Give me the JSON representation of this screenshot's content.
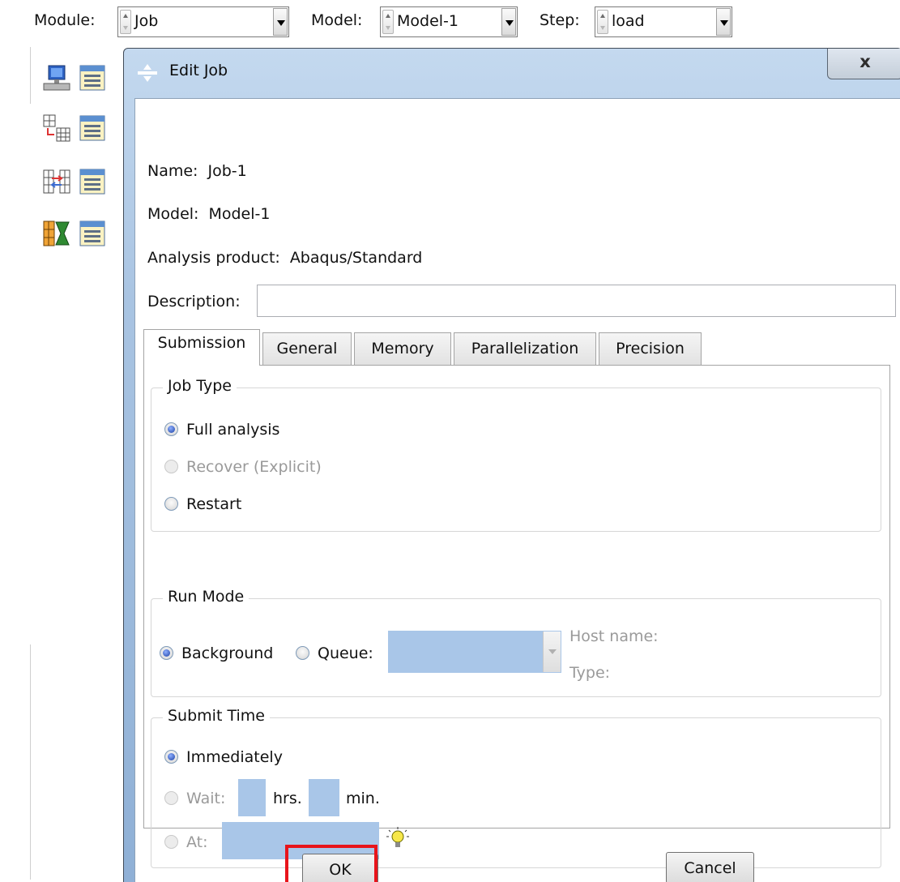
{
  "context_bar": {
    "module_label": "Module:",
    "module_value": "Job",
    "model_label": "Model:",
    "model_value": "Model-1",
    "step_label": "Step:",
    "step_value": "load"
  },
  "toolbox": {
    "tools": [
      {
        "icon": "job-create-icon"
      },
      {
        "icon": "job-manager-icon"
      },
      {
        "icon": "adaptivity-create-icon"
      },
      {
        "icon": "adaptivity-manager-icon"
      },
      {
        "icon": "co-execution-create-icon"
      },
      {
        "icon": "co-execution-manager-icon"
      },
      {
        "icon": "optimization-create-icon"
      },
      {
        "icon": "optimization-manager-icon"
      }
    ]
  },
  "dialog": {
    "title": "Edit Job",
    "close_label": "x",
    "name_label": "Name:",
    "name_value": "Job-1",
    "model_label": "Model:",
    "model_value": "Model-1",
    "product_label": "Analysis product:",
    "product_value": "Abaqus/Standard",
    "description_label": "Description:",
    "description_value": "",
    "tabs": [
      "Submission",
      "General",
      "Memory",
      "Parallelization",
      "Precision"
    ],
    "active_tab": "Submission",
    "job_type": {
      "title": "Job Type",
      "options": [
        "Full analysis",
        "Recover (Explicit)",
        "Restart"
      ],
      "selected": "Full analysis"
    },
    "run_mode": {
      "title": "Run Mode",
      "background_label": "Background",
      "queue_label": "Queue:",
      "host_name_label": "Host name:",
      "type_label": "Type:",
      "selected": "Background"
    },
    "submit_time": {
      "title": "Submit Time",
      "immediately_label": "Immediately",
      "wait_label": "Wait:",
      "hrs_label": "hrs.",
      "min_label": "min.",
      "at_label": "At:",
      "selected": "Immediately"
    },
    "ok_label": "OK",
    "cancel_label": "Cancel"
  },
  "colors": {
    "highlight": "#e8141b",
    "field_blue": "#a9c6e8",
    "title_gradient": "#a9c4e2"
  }
}
